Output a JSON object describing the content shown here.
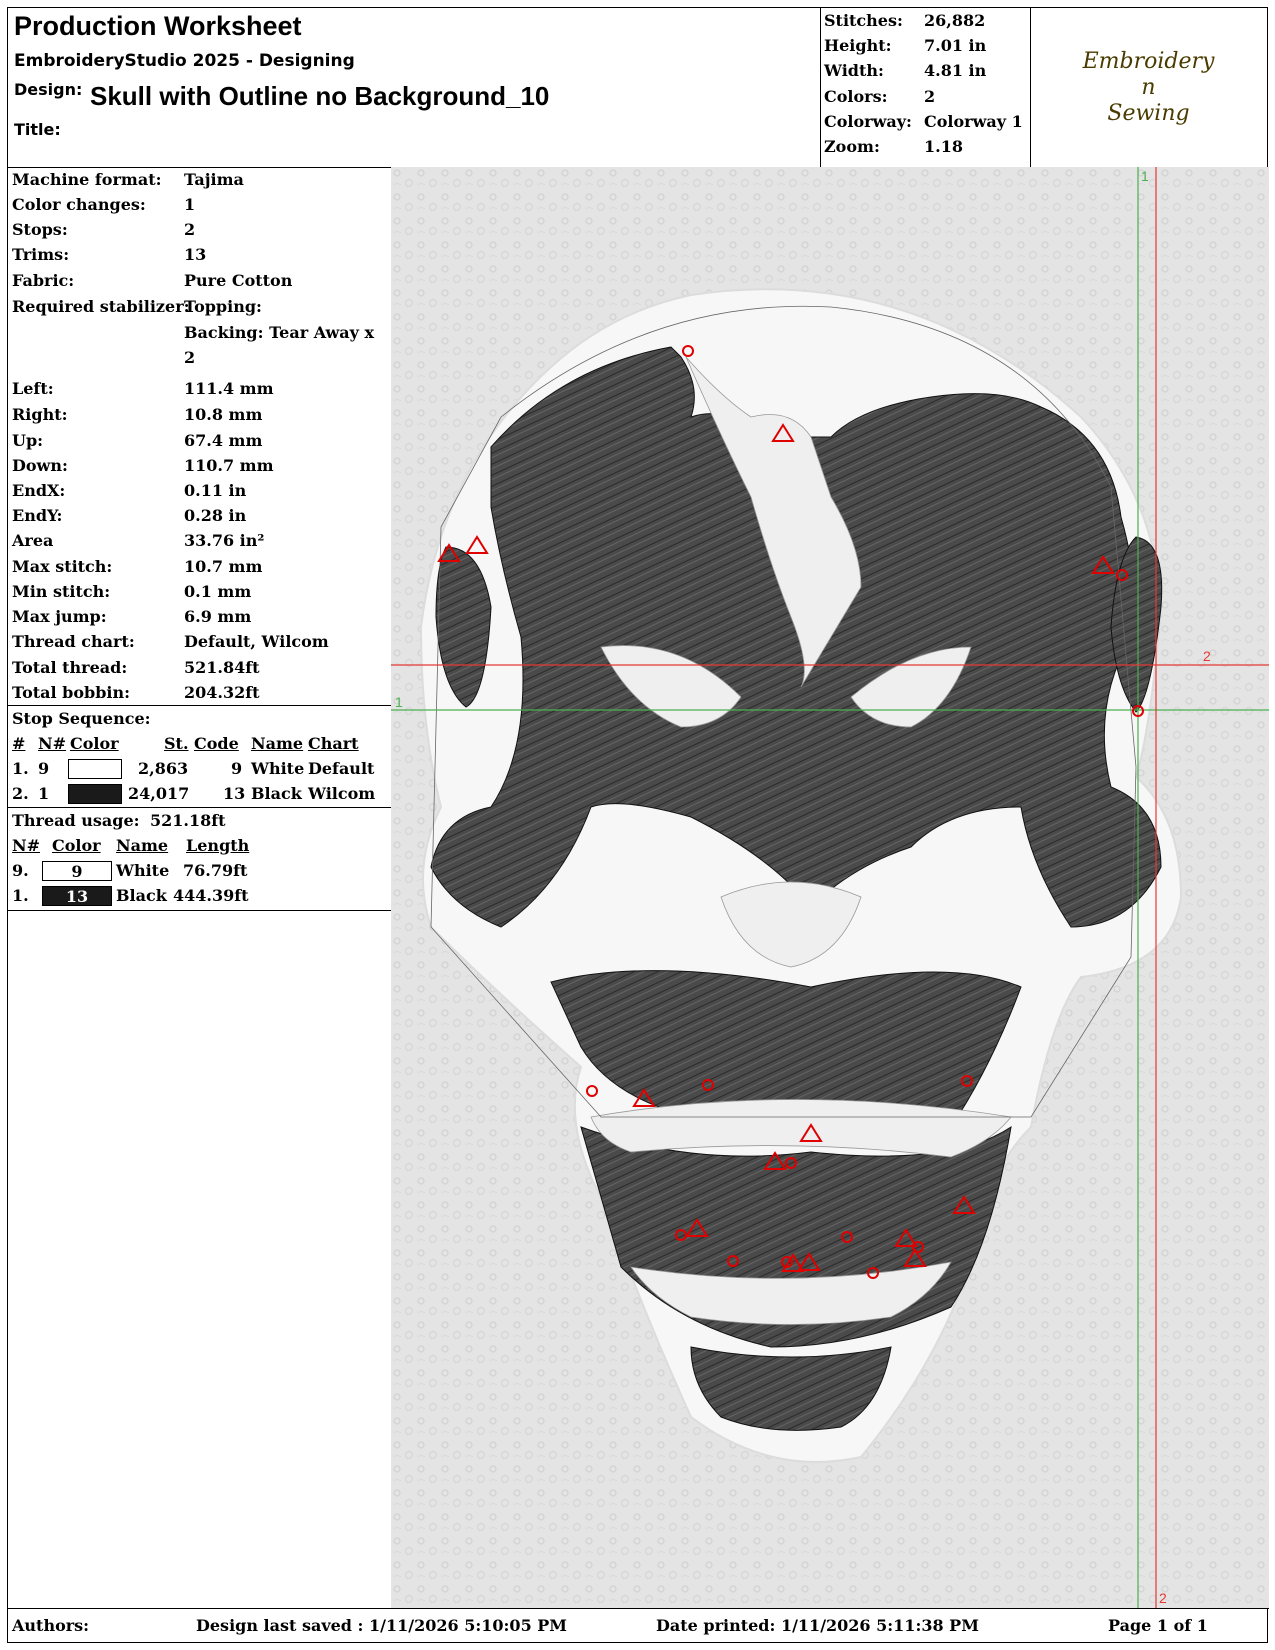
{
  "header": {
    "title": "Production Worksheet",
    "subtitle": "EmbroideryStudio 2025 - Designing",
    "design_label": "Design:",
    "design_value": "Skull with Outline no Background_10",
    "title_label": "Title:",
    "title_value": ""
  },
  "metrics": [
    {
      "label": "Stitches:",
      "value": "26,882"
    },
    {
      "label": "Height:",
      "value": "7.01 in"
    },
    {
      "label": "Width:",
      "value": "4.81 in"
    },
    {
      "label": "Colors:",
      "value": "2"
    },
    {
      "label": "Colorway:",
      "value": "Colorway 1"
    },
    {
      "label": "Zoom:",
      "value": "1.18"
    }
  ],
  "logo": {
    "line1": "Embroidery",
    "line2": "n",
    "line3": "Sewing"
  },
  "specs": [
    {
      "label": "Machine format:",
      "value": "Tajima"
    },
    {
      "label": "Color changes:",
      "value": "1"
    },
    {
      "label": "Stops:",
      "value": "2"
    },
    {
      "label": "Trims:",
      "value": "13"
    },
    {
      "label": "Fabric:",
      "value": "Pure Cotton"
    },
    {
      "label": "Required stabilizer:",
      "value": "Topping:"
    },
    {
      "label": "",
      "value": "Backing: Tear Away x"
    },
    {
      "label": "",
      "value": "2"
    },
    {
      "label": "Left:",
      "value": "111.4 mm"
    },
    {
      "label": "Right:",
      "value": "10.8 mm"
    },
    {
      "label": "Up:",
      "value": "67.4 mm"
    },
    {
      "label": "Down:",
      "value": "110.7 mm"
    },
    {
      "label": "EndX:",
      "value": "0.11 in"
    },
    {
      "label": "EndY:",
      "value": "0.28 in"
    },
    {
      "label": "Area",
      "value": " 33.76 in²"
    },
    {
      "label": "Max stitch:",
      "value": "10.7 mm"
    },
    {
      "label": "Min stitch:",
      "value": "0.1 mm"
    },
    {
      "label": "Max jump:",
      "value": "6.9 mm"
    },
    {
      "label": "Thread chart:",
      "value": "Default, Wilcom"
    },
    {
      "label": "Total thread:",
      "value": "521.84ft"
    },
    {
      "label": "Total bobbin:",
      "value": "204.32ft"
    }
  ],
  "stop_sequence": {
    "heading": "Stop Sequence:",
    "columns": [
      "#",
      "N#",
      "Color",
      "St.",
      "Code",
      "Name",
      "Chart"
    ],
    "rows": [
      {
        "num": "1.",
        "n": "9",
        "color": "#ffffff",
        "stitches": "2,863",
        "code": "9",
        "name": "White",
        "chart": "Default"
      },
      {
        "num": "2.",
        "n": "1",
        "color": "#1a1a1a",
        "stitches": "24,017",
        "code": "13",
        "name": "Black",
        "chart": "Wilcom"
      }
    ]
  },
  "thread_usage": {
    "label": "Thread usage:",
    "total": "521.18ft",
    "columns": [
      "N#",
      "Color",
      "Name",
      "Length"
    ],
    "rows": [
      {
        "n": "9.",
        "code": "9",
        "color": "#ffffff",
        "text_color": "#000000",
        "name": "White",
        "length": "76.79ft"
      },
      {
        "n": "1.",
        "code": "13",
        "color": "#1a1a1a",
        "text_color": "#ffffff",
        "name": "Black",
        "length": "444.39ft"
      }
    ]
  },
  "guides": {
    "v_green": "1",
    "h_red": "2",
    "h_green": "1",
    "v_red": "2"
  },
  "footer": {
    "authors_label": "Authors:",
    "saved": "Design last saved : 1/11/2026 5:10:05 PM",
    "printed": "Date printed: 1/11/2026 5:11:38 PM",
    "page": "Page 1 of 1"
  }
}
